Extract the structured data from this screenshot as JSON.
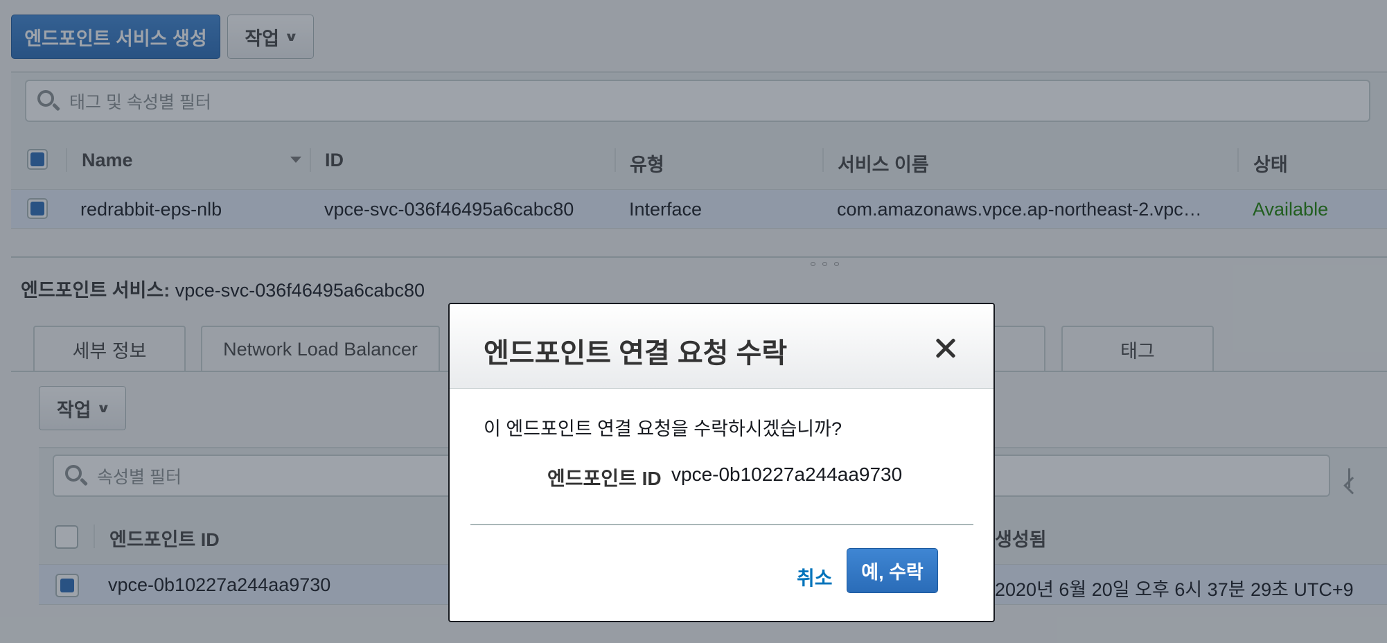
{
  "toolbar": {
    "create_label": "엔드포인트 서비스 생성",
    "actions_label": "작업"
  },
  "top_filter": {
    "placeholder": "태그 및 속성별 필터"
  },
  "services_table": {
    "columns": [
      "Name",
      "ID",
      "유형",
      "서비스 이름",
      "상태"
    ],
    "row": {
      "name": "redrabbit-eps-nlb",
      "id": "vpce-svc-036f46495a6cabc80",
      "type": "Interface",
      "service_name": "com.amazonaws.vpce.ap-northeast-2.vpc…",
      "status": "Available"
    }
  },
  "detail": {
    "label": "엔드포인트 서비스:",
    "value": "vpce-svc-036f46495a6cabc80",
    "tabs": [
      "세부 정보",
      "Network Load Balancer",
      "태그"
    ],
    "actions_label": "작업",
    "filter_placeholder": "속성별 필터",
    "columns": [
      "엔드포인트 ID",
      "생성됨"
    ],
    "row": {
      "endpoint_id": "vpce-0b10227a244aa9730",
      "created": "2020년 6월 20일 오후 6시 37분 29초 UTC+9"
    }
  },
  "modal": {
    "title": "엔드포인트 연결 요청 수락",
    "question": "이 엔드포인트 연결 요청을 수락하시겠습니까?",
    "key": "엔드포인트 ID",
    "value": "vpce-0b10227a244aa9730",
    "cancel_label": "취소",
    "confirm_label": "예, 수락"
  },
  "colors": {
    "primary": "#2a6cb8",
    "link": "#0073bb",
    "available": "#1d8102"
  }
}
